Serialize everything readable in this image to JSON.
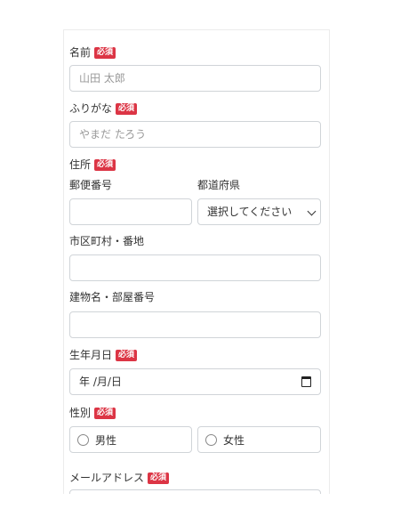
{
  "form": {
    "name": {
      "label": "名前",
      "required": "必須",
      "placeholder": "山田 太郎"
    },
    "kana": {
      "label": "ふりがな",
      "required": "必須",
      "placeholder": "やまだ たろう"
    },
    "address": {
      "label": "住所",
      "required": "必須",
      "postal_label": "郵便番号",
      "prefecture_label": "都道府県",
      "prefecture_value": "選択してください",
      "city_label": "市区町村・番地",
      "building_label": "建物名・部屋番号"
    },
    "birthdate": {
      "label": "生年月日",
      "required": "必須",
      "value": "年 /月/日"
    },
    "gender": {
      "label": "性別",
      "required": "必須",
      "options": [
        "男性",
        "女性"
      ]
    },
    "email": {
      "label": "メールアドレス",
      "required": "必須"
    }
  }
}
